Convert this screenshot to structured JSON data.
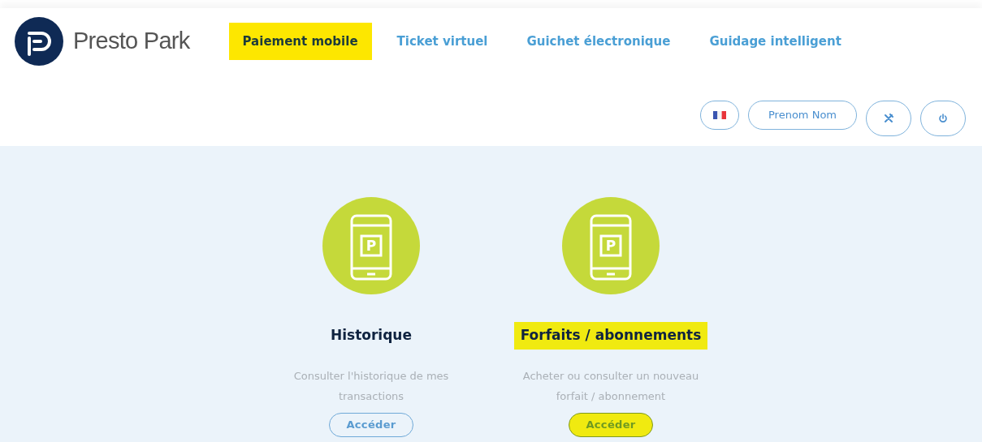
{
  "brand": {
    "name": "Presto Park"
  },
  "nav": [
    {
      "label": "Paiement mobile",
      "selected": true,
      "highlighted": true
    },
    {
      "label": "Ticket virtuel",
      "selected": false,
      "highlighted": false
    },
    {
      "label": "Guichet électronique",
      "selected": false,
      "highlighted": false
    },
    {
      "label": "Guidage intelligent",
      "selected": false,
      "highlighted": false
    }
  ],
  "user": {
    "name": "Prenom Nom"
  },
  "cards": [
    {
      "icon_label": "P",
      "title": "Historique",
      "title_highlighted": false,
      "description": "Consulter l'historique de mes transactions",
      "button": "Accéder",
      "button_highlighted": false
    },
    {
      "icon_label": "P",
      "title": "Forfaits / abonnements",
      "title_highlighted": true,
      "description": "Acheter ou consulter un nouveau forfait / abonnement",
      "button": "Accéder",
      "button_highlighted": true
    }
  ]
}
